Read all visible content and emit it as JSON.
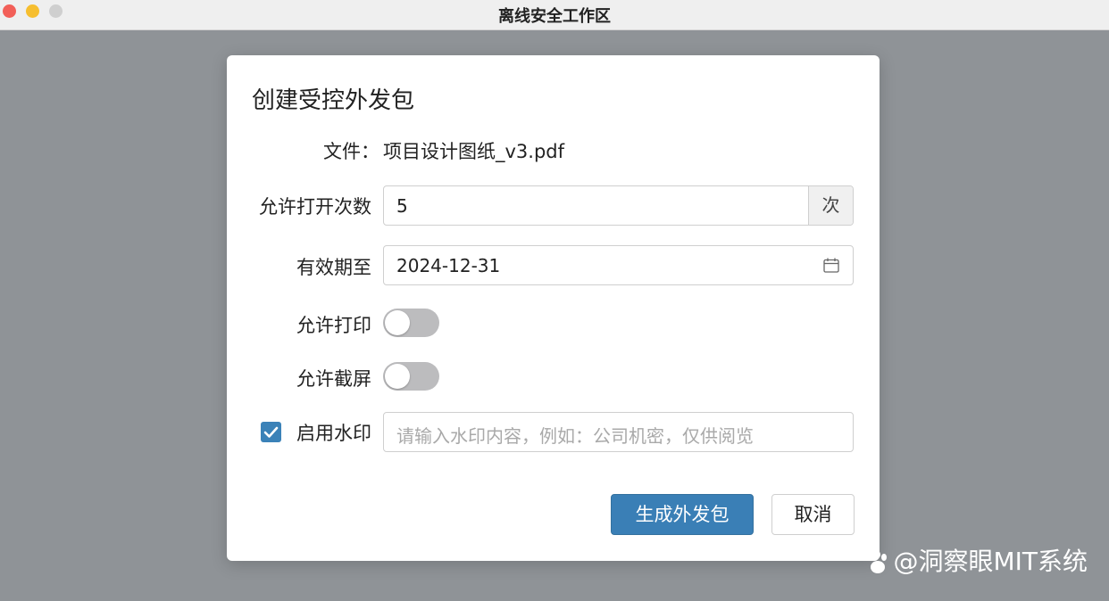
{
  "window": {
    "title": "离线安全工作区"
  },
  "dialog": {
    "title": "创建受控外发包",
    "file": {
      "label": "文件：",
      "name": "项目设计图纸_v3.pdf"
    },
    "open_count": {
      "label": "允许打开次数",
      "value": "5",
      "unit": "次"
    },
    "expiry": {
      "label": "有效期至",
      "value": "2024-12-31",
      "icon": "calendar-icon"
    },
    "allow_print": {
      "label": "允许打印",
      "on": false
    },
    "allow_screenshot": {
      "label": "允许截屏",
      "on": false
    },
    "watermark": {
      "label": "启用水印",
      "checked": true,
      "placeholder": "请输入水印内容，例如：公司机密，仅供阅览",
      "value": ""
    },
    "buttons": {
      "generate": "生成外发包",
      "cancel": "取消"
    }
  },
  "source_watermark": {
    "text": "@洞察眼MIT系统",
    "icon": "paw-icon"
  },
  "colors": {
    "accent": "#3a7fb6",
    "backdrop": "#8f9397",
    "toggle_off": "#bcbcbe"
  }
}
